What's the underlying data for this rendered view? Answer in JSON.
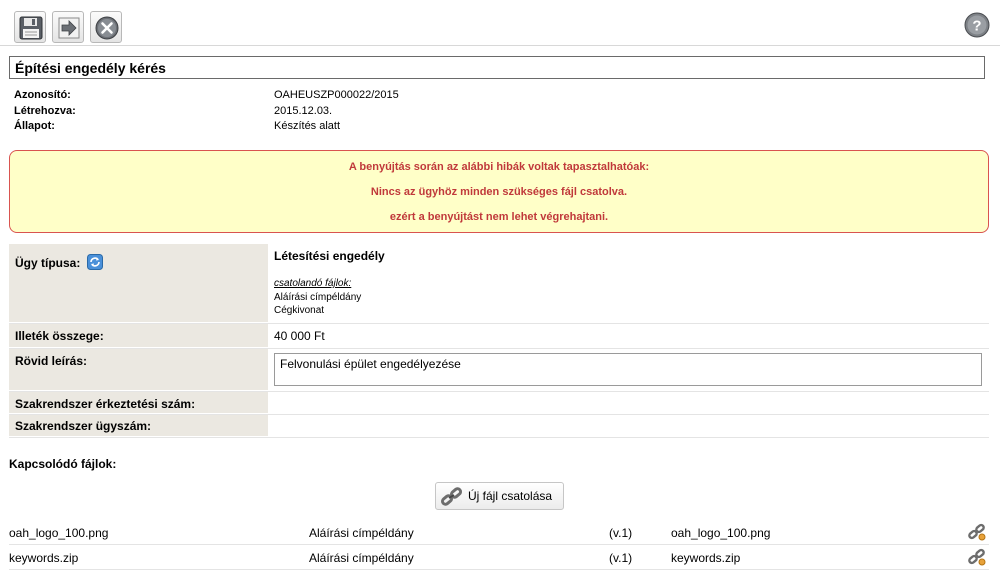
{
  "toolbar": {
    "save_icon": "floppy-disk-icon",
    "forward_icon": "arrow-right-icon",
    "close_icon": "close-circle-icon",
    "help_icon": "question-mark-icon"
  },
  "page_title": "Építési engedély kérés",
  "meta": {
    "id_label": "Azonosító:",
    "id_value": "OAHEUSZP000022/2015",
    "created_label": "Létrehozva:",
    "created_value": "2015.12.03.",
    "state_label": "Állapot:",
    "state_value": "Készítés alatt"
  },
  "alert": {
    "line1": "A benyújtás során az alábbi hibák voltak tapasztalhatóak:",
    "line2": "Nincs az ügyhöz minden szükséges fájl csatolva.",
    "line3": "ezért a benyújtást nem lehet végrehajtani.",
    "border_color": "#d9534f",
    "text_color": "#c0393b",
    "bg_color": "#ffffc8"
  },
  "form": {
    "case_type_label": "Ügy típusa:",
    "case_type_value": "Létesítési engedély",
    "required_files_label": "csatolandó fájlok:",
    "required_files": [
      "Aláírási címpéldány",
      "Cégkivonat"
    ],
    "fee_label": "Illeték összege:",
    "fee_value": "40 000 Ft",
    "short_desc_label": "Rövid leírás:",
    "short_desc_value": "Felvonulási épület engedélyezése",
    "arrival_no_label": "Szakrendszer érkeztetési szám:",
    "arrival_no_value": "",
    "case_no_label": "Szakrendszer ügyszám:",
    "case_no_value": ""
  },
  "files": {
    "heading": "Kapcsolódó fájlok:",
    "attach_button": "Új fájl csatolása",
    "rows": [
      {
        "name": "oah_logo_100.png",
        "type": "Aláírási címpéldány",
        "version": "(v.1)",
        "original": "oah_logo_100.png"
      },
      {
        "name": "keywords.zip",
        "type": "Aláírási címpéldány",
        "version": "(v.1)",
        "original": "keywords.zip"
      }
    ]
  }
}
